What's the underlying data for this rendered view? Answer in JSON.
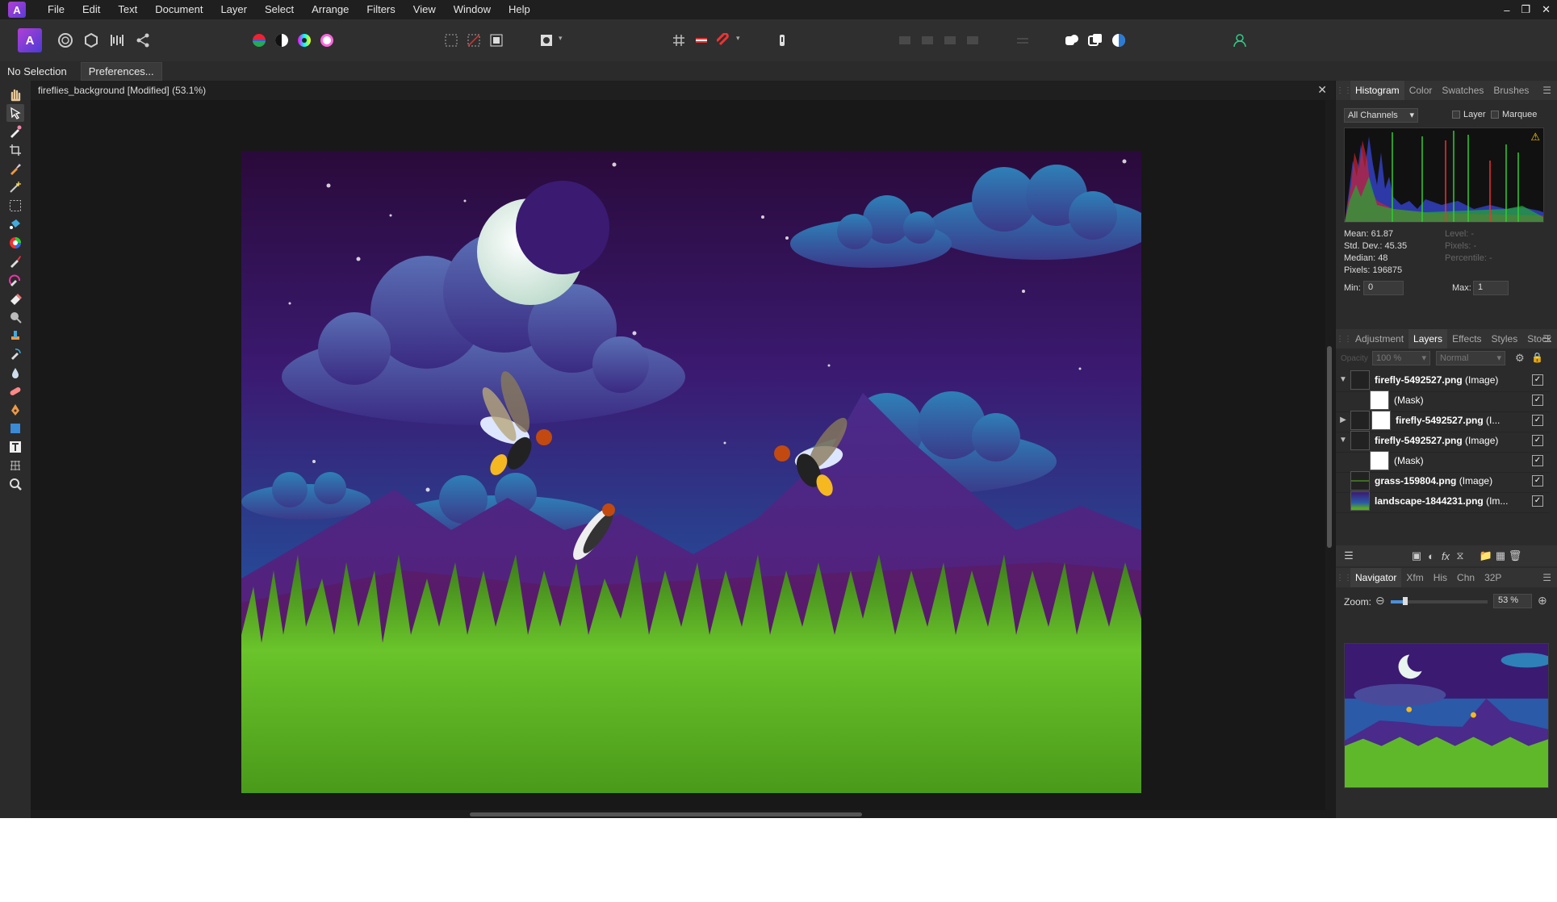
{
  "menubar": {
    "items": [
      "File",
      "Edit",
      "Text",
      "Document",
      "Layer",
      "Select",
      "Arrange",
      "Filters",
      "View",
      "Window",
      "Help"
    ]
  },
  "contextbar": {
    "selection_text": "No Selection",
    "preferences_label": "Preferences..."
  },
  "document": {
    "title": "fireflies_background [Modified] (53.1%)"
  },
  "histogram_panel": {
    "tabs": [
      "Histogram",
      "Color",
      "Swatches",
      "Brushes"
    ],
    "channel": "All Channels",
    "layer_label": "Layer",
    "marquee_label": "Marquee",
    "mean": "Mean: 61.87",
    "std_dev": "Std. Dev.: 45.35",
    "median": "Median: 48",
    "pixels": "Pixels: 196875",
    "level": "Level: -",
    "pixels2": "Pixels: -",
    "percentile": "Percentile: -",
    "min_label": "Min:",
    "min_value": "0",
    "max_label": "Max:",
    "max_value": "1"
  },
  "layers_panel": {
    "tabs": [
      "Adjustment",
      "Layers",
      "Effects",
      "Styles",
      "Stock"
    ],
    "opacity_label": "Opacity",
    "opacity_value": "100 %",
    "blend_mode": "Normal",
    "layers": [
      {
        "name": "firefly-5492527.png",
        "type": " (Image)",
        "arrow": "▼"
      },
      {
        "name": "",
        "type": "(Mask)",
        "arrow": ""
      },
      {
        "name": "firefly-5492527.png",
        "type": " (I...",
        "arrow": "▶"
      },
      {
        "name": "firefly-5492527.png",
        "type": " (Image)",
        "arrow": "▼"
      },
      {
        "name": "",
        "type": "(Mask)",
        "arrow": ""
      },
      {
        "name": "grass-159804.png",
        "type": " (Image)",
        "arrow": ""
      },
      {
        "name": "landscape-1844231.png",
        "type": " (Im...",
        "arrow": ""
      }
    ]
  },
  "navigator_panel": {
    "tabs": [
      "Navigator",
      "Xfm",
      "His",
      "Chn",
      "32P"
    ],
    "zoom_label": "Zoom:",
    "zoom_value": "53 %",
    "zoom_level": 0.53
  },
  "colors": {
    "accent": "#c23fd6",
    "sky_top": "#2a0a3a",
    "sky_bottom": "#1f4f9a",
    "grass": "#5fb82a"
  }
}
